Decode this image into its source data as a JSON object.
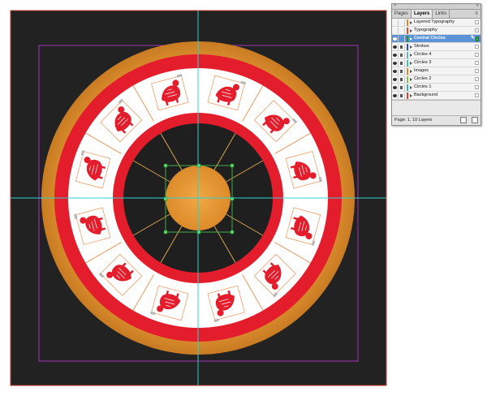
{
  "document": {
    "pasteboard_color": "#ffffff",
    "page_color": "#222222",
    "bleed_color": "#c0392b",
    "margin_color": "#a235b5",
    "guide_color": "#2fd3cf"
  },
  "artwork": {
    "colors": {
      "outer_gold": "#e59a3a",
      "red": "#e41d2c",
      "white": "#ffffff",
      "center_gold": "#e7962f",
      "spoke": "#d9a24a",
      "thin_line": "#ef7f3a"
    },
    "zodiac_icons": [
      "dragon-icon",
      "rabbit-icon",
      "tiger-icon",
      "ox-icon",
      "rat-icon",
      "pig-icon",
      "dog-icon",
      "rooster-icon",
      "monkey-icon",
      "goat-icon",
      "horse-icon",
      "snake-icon"
    ]
  },
  "layers_panel": {
    "tabs": [
      "Pages",
      "Layers",
      "Links"
    ],
    "active_tab": "Layers",
    "layers": [
      {
        "name": "Layered Typography",
        "color": "#e2892a",
        "visible": false,
        "locked": false,
        "selected": false
      },
      {
        "name": "Typography",
        "color": "#e64a26",
        "visible": false,
        "locked": false,
        "selected": false
      },
      {
        "name": "Central Circles",
        "color": "#2a8f3a",
        "visible": true,
        "locked": false,
        "selected": true
      },
      {
        "name": "Strokes",
        "color": "#2a4fd0",
        "visible": true,
        "locked": true,
        "selected": false
      },
      {
        "name": "Circles 4",
        "color": "#6ab6b1",
        "visible": true,
        "locked": true,
        "selected": false
      },
      {
        "name": "Circles 3",
        "color": "#39c7a4",
        "visible": true,
        "locked": true,
        "selected": false
      },
      {
        "name": "Images",
        "color": "#e08a2f",
        "visible": true,
        "locked": true,
        "selected": false
      },
      {
        "name": "Circles 2",
        "color": "#8ac44a",
        "visible": true,
        "locked": true,
        "selected": false
      },
      {
        "name": "Circles 1",
        "color": "#3fb0c7",
        "visible": true,
        "locked": true,
        "selected": false
      },
      {
        "name": "Background",
        "color": "#e1402a",
        "visible": true,
        "locked": true,
        "selected": false
      }
    ],
    "footer": "Page: 1, 10 Layers"
  }
}
